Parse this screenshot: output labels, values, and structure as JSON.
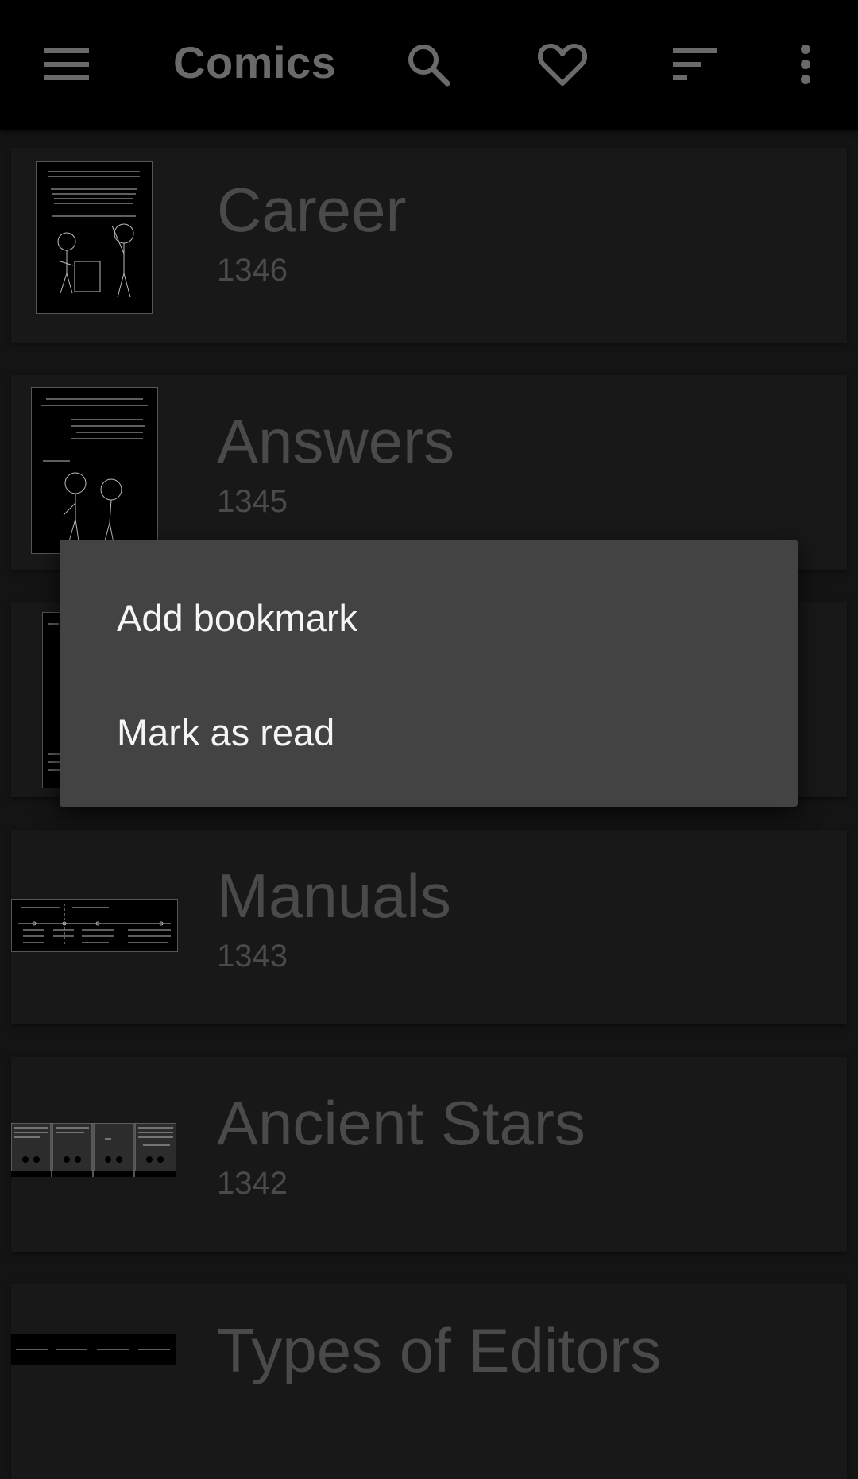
{
  "app_bar": {
    "title": "Comics",
    "icons": [
      "menu-icon",
      "search-icon",
      "heart-icon",
      "sort-icon",
      "overflow-icon"
    ]
  },
  "comics": [
    {
      "title": "Career",
      "number": "1346",
      "thumb_caption": "WHEN PEOPLE ASK ME TO DESCRIBE MY DREAM JOB, I'M NEVER SURE HOW REALISTIC TO BE."
    },
    {
      "title": "Answers",
      "number": "1345",
      "thumb_caption": "HUMANS ARE DEFINED BY OUR CURIOSITY, OUR HUNGER FOR ANSWERS."
    },
    {
      "title": "",
      "number": "",
      "thumb_caption": ""
    },
    {
      "title": "Manuals",
      "number": "1343",
      "thumb_caption": ""
    },
    {
      "title": "Ancient Stars",
      "number": "1342",
      "thumb_caption": ""
    },
    {
      "title": "Types of Editors",
      "number": "",
      "thumb_caption": ""
    }
  ],
  "context_menu": {
    "items": [
      "Add bookmark",
      "Mark as read"
    ]
  },
  "colors": {
    "app_bar": "#000000",
    "background": "#141414",
    "card": "#181818",
    "menu": "#434343",
    "menu_text": "#f5f5f5",
    "dim_text": "#4a4a4a"
  }
}
